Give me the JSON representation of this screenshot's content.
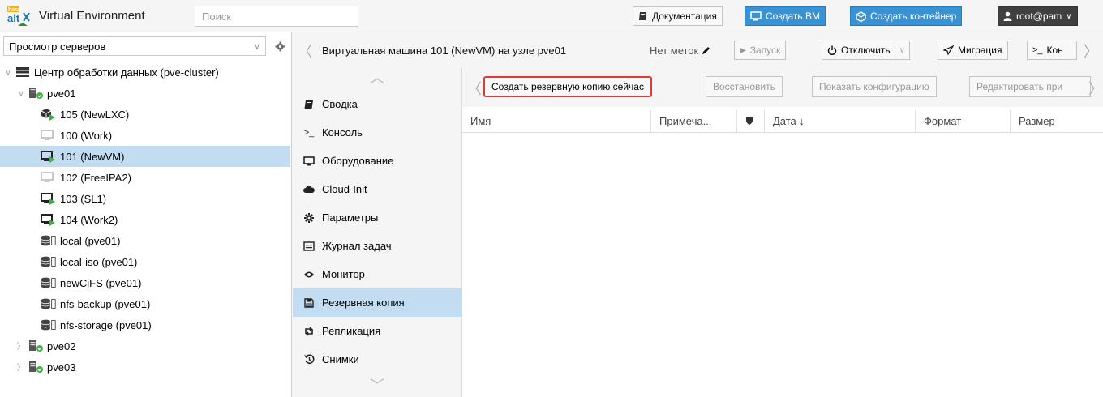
{
  "app": {
    "logo_text_top": "base",
    "logo_text": "alt",
    "title": "Virtual Environment",
    "search_placeholder": "Поиск"
  },
  "topbar": {
    "docs_label": "Документация",
    "create_vm_label": "Создать ВМ",
    "create_ct_label": "Создать контейнер",
    "user_label": "root@pam"
  },
  "left": {
    "view_label": "Просмотр серверов",
    "tree": [
      {
        "label": "Центр обработки данных (pve-cluster)",
        "icon": "datacenter-icon",
        "indent": 0,
        "twisty": "expanded"
      },
      {
        "label": "pve01",
        "icon": "node-online-icon",
        "indent": 1,
        "twisty": "expanded"
      },
      {
        "label": "105 (NewLXC)",
        "icon": "container-running-icon",
        "indent": 2,
        "twisty": ""
      },
      {
        "label": "100 (Work)",
        "icon": "vm-stopped-icon",
        "indent": 2,
        "twisty": ""
      },
      {
        "label": "101 (NewVM)",
        "icon": "vm-running-icon",
        "indent": 2,
        "twisty": "",
        "selected": true
      },
      {
        "label": "102 (FreeIPA2)",
        "icon": "vm-stopped-icon",
        "indent": 2,
        "twisty": ""
      },
      {
        "label": "103 (SL1)",
        "icon": "vm-running-icon",
        "indent": 2,
        "twisty": ""
      },
      {
        "label": "104 (Work2)",
        "icon": "vm-running-icon",
        "indent": 2,
        "twisty": ""
      },
      {
        "label": "local (pve01)",
        "icon": "storage-icon",
        "indent": 2,
        "twisty": ""
      },
      {
        "label": "local-iso (pve01)",
        "icon": "storage-icon",
        "indent": 2,
        "twisty": ""
      },
      {
        "label": "newCiFS (pve01)",
        "icon": "storage-icon",
        "indent": 2,
        "twisty": ""
      },
      {
        "label": "nfs-backup (pve01)",
        "icon": "storage-icon",
        "indent": 2,
        "twisty": ""
      },
      {
        "label": "nfs-storage (pve01)",
        "icon": "storage-icon",
        "indent": 2,
        "twisty": ""
      },
      {
        "label": "pve02",
        "icon": "node-online-icon",
        "indent": 1,
        "twisty": "collapsed"
      },
      {
        "label": "pve03",
        "icon": "node-online-icon",
        "indent": 1,
        "twisty": "collapsed"
      }
    ]
  },
  "header": {
    "vm_title": "Виртуальная машина 101 (NewVM) на узле pve01",
    "tags_label": "Нет меток",
    "start_label": "Запуск",
    "shutdown_label": "Отключить",
    "migrate_label": "Миграция",
    "console_label": "Кон"
  },
  "menu": {
    "items": [
      {
        "label": "Сводка",
        "icon": "summary-book-icon"
      },
      {
        "label": "Консоль",
        "icon": "console-prompt-icon"
      },
      {
        "label": "Оборудование",
        "icon": "hardware-monitor-icon"
      },
      {
        "label": "Cloud-Init",
        "icon": "cloud-icon"
      },
      {
        "label": "Параметры",
        "icon": "gear-icon"
      },
      {
        "label": "Журнал задач",
        "icon": "task-list-icon"
      },
      {
        "label": "Монитор",
        "icon": "eye-icon"
      },
      {
        "label": "Резервная копия",
        "icon": "floppy-icon",
        "selected": true
      },
      {
        "label": "Репликация",
        "icon": "retweet-icon"
      },
      {
        "label": "Снимки",
        "icon": "history-icon"
      }
    ]
  },
  "backup": {
    "backup_now_label": "Создать резервную копию сейчас",
    "restore_label": "Восстановить",
    "show_config_label": "Показать конфигурацию",
    "edit_label": "Редактировать при",
    "columns": [
      "Имя",
      "Примеча...",
      "",
      "Дата ↓",
      "Формат",
      "Размер"
    ]
  },
  "colors": {
    "accent_blue": "#3892d4",
    "selection": "#c2ddf2",
    "highlight_red": "#e53935",
    "running_green": "#3db142"
  }
}
